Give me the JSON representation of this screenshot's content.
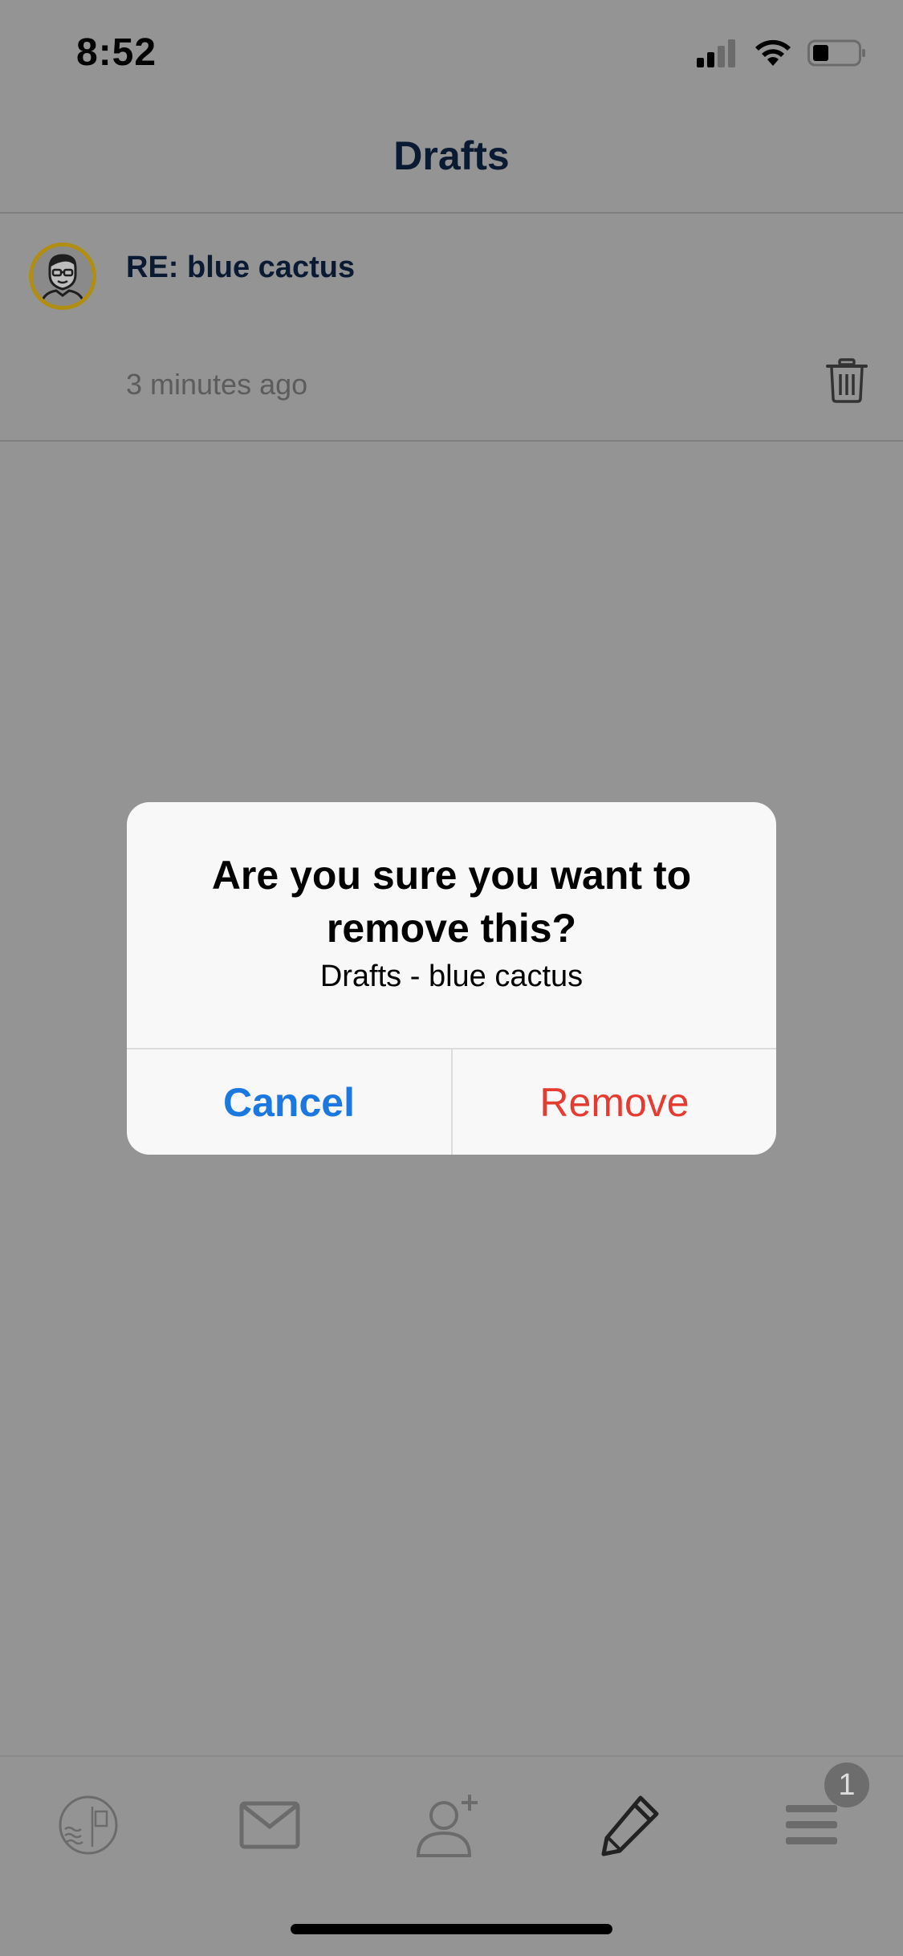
{
  "status_bar": {
    "time": "8:52",
    "icons": [
      "cellular-signal-icon",
      "wifi-icon",
      "battery-icon"
    ]
  },
  "header": {
    "title": "Drafts"
  },
  "drafts": [
    {
      "subject": "RE: blue cactus",
      "time": "3 minutes ago",
      "avatar": "user-avatar-icon"
    }
  ],
  "alert": {
    "title": "Are you sure you want to remove this?",
    "message": "Drafts - blue cactus",
    "cancel_label": "Cancel",
    "remove_label": "Remove"
  },
  "tabbar": {
    "tabs": [
      "stamp-icon",
      "mail-icon",
      "add-contact-icon",
      "compose-pencil-icon",
      "menu-icon"
    ],
    "menu_badge": "1"
  },
  "colors": {
    "overlay": "#949494",
    "cancel": "#1a78e0",
    "remove": "#e53b30",
    "avatar_ring": "#b08e12"
  }
}
